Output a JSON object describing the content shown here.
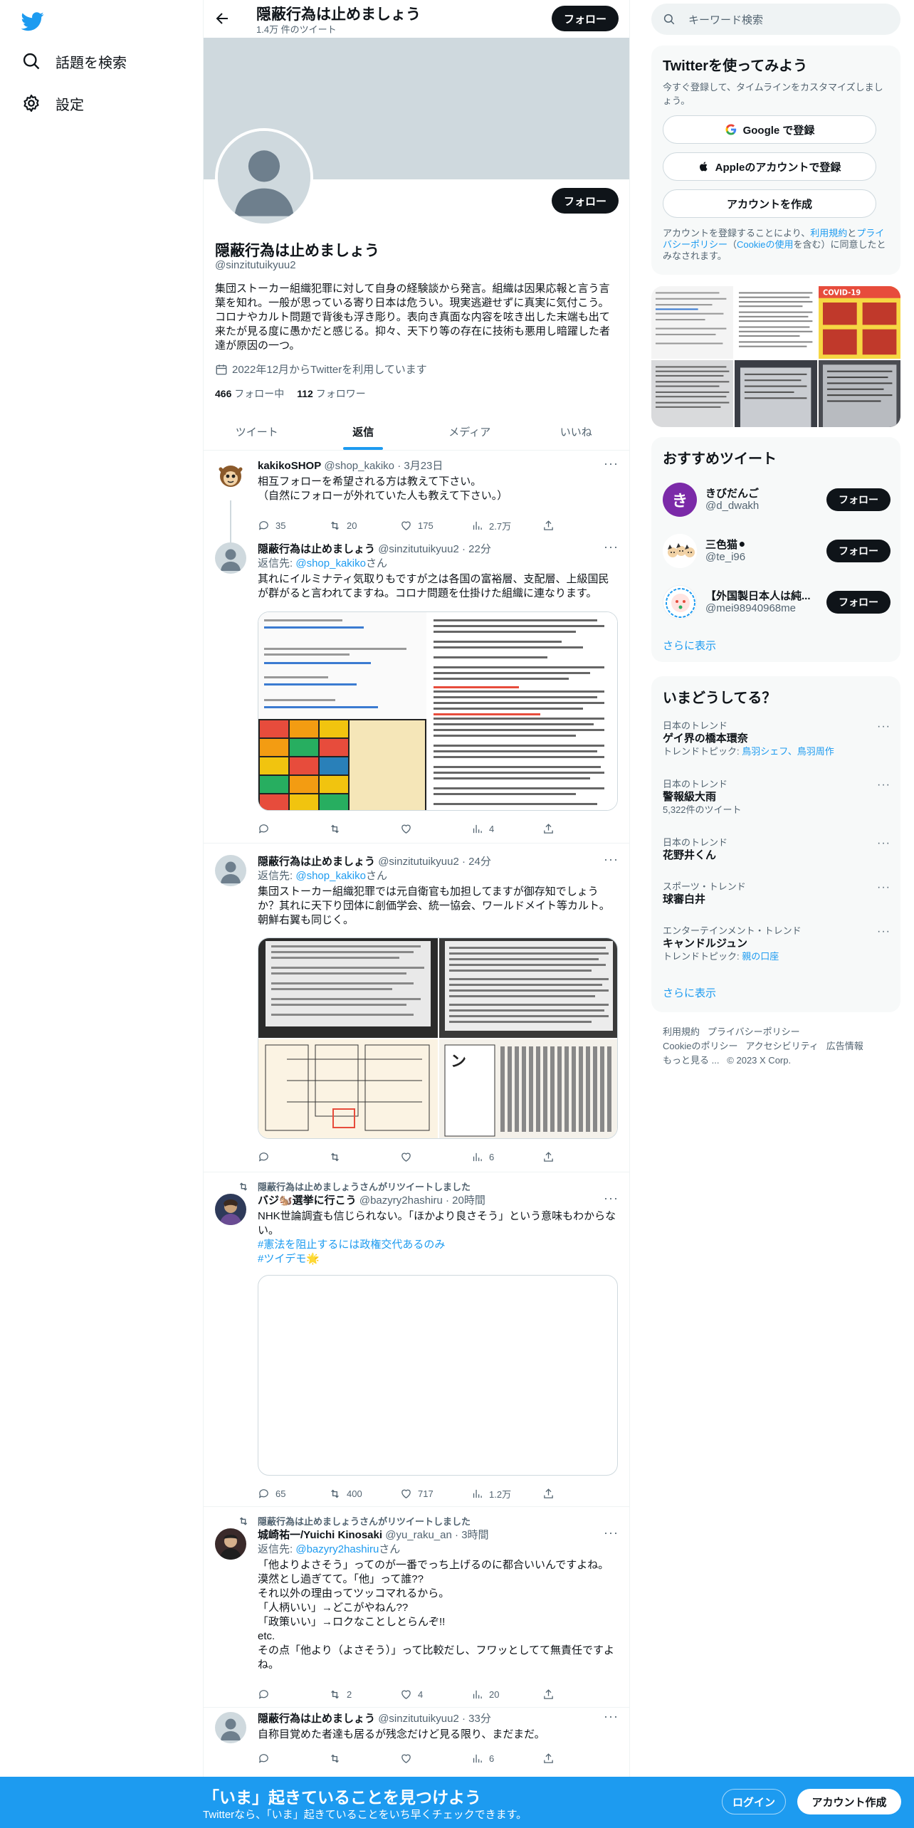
{
  "nav": {
    "explore_label": "話題を検索",
    "settings_label": "設定"
  },
  "header": {
    "title": "隠蔽行為は止めましょう",
    "tweet_count": "1.4万 件のツイート",
    "follow_label": "フォロー"
  },
  "profile": {
    "name": "隠蔽行為は止めましょう",
    "handle": "@sinzitutuikyuu2",
    "follow_label": "フォロー",
    "bio": "集団ストーカー組織犯罪に対して自身の経験談から発言。組織は因果応報と言う言葉を知れ。一般が思っている寄り日本は危うい。現実逃避せずに真実に気付こう。コロナやカルト問題で背後も浮き彫り。表向き真面な内容を呟き出した末端も出て来たが見る度に愚かだと感じる。抑々、天下り等の存在に技術も悪用し暗躍した者達が原因の一つ。",
    "joined": "2022年12月からTwitterを利用しています",
    "following_count": "466",
    "following_label": "フォロー中",
    "followers_count": "112",
    "followers_label": "フォロワー"
  },
  "tabs": [
    {
      "label": "ツイート"
    },
    {
      "label": "返信"
    },
    {
      "label": "メディア"
    },
    {
      "label": "いいね"
    }
  ],
  "tweets": [
    {
      "name": "kakikoSHOP",
      "handle": "@shop_kakiko",
      "time": "3月23日",
      "text": "相互フォローを希望される方は教えて下さい。\n（自然にフォローが外れていた人も教えて下さい。）",
      "replies": "35",
      "retweets": "20",
      "likes": "175",
      "views": "2.7万"
    },
    {
      "name": "隠蔽行為は止めましょう",
      "handle": "@sinzitutuikyuu2",
      "time": "22分",
      "reply_prefix": "返信先: ",
      "reply_to": "@shop_kakiko",
      "reply_suffix": "さん",
      "text": "其れにイルミナティ気取りもですが之は各国の富裕層、支配層、上級国民が群がると言われてますね。コロナ問題を仕掛けた組織に連なります。",
      "replies": "",
      "retweets": "",
      "likes": "",
      "views": "4"
    },
    {
      "name": "隠蔽行為は止めましょう",
      "handle": "@sinzitutuikyuu2",
      "time": "24分",
      "reply_prefix": "返信先: ",
      "reply_to": "@shop_kakiko",
      "reply_suffix": "さん",
      "text": "集団ストーカー組織犯罪では元自衛官も加担してますが御存知でしょうか？其れに天下り団体に創価学会、統一協会、ワールドメイト等カルト。朝鮮右翼も同じく。",
      "replies": "",
      "retweets": "",
      "likes": "",
      "views": "6"
    },
    {
      "retweet_by": "隠蔽行為は止めましょうさんがリツイートしました",
      "name": "バジ🐿️選挙に行こう",
      "handle": "@bazyry2hashiru",
      "time": "20時間",
      "text": "NHK世論調査も信じられない。「ほかより良さそう」という意味もわからない。",
      "hashtag1": "#憲法を阻止するには政権交代あるのみ",
      "hashtag2": "#ツイデモ🌟",
      "replies": "65",
      "retweets": "400",
      "likes": "717",
      "views": "1.2万"
    },
    {
      "retweet_by": "隠蔽行為は止めましょうさんがリツイートしました",
      "name": "城崎祐一/Yuichi Kinosaki",
      "handle": "@yu_raku_an",
      "time": "3時間",
      "reply_prefix": "返信先: ",
      "reply_to": "@bazyry2hashiru",
      "reply_suffix": "さん",
      "text": "「他よりよさそう」ってのが一番でっち上げるのに都合いいんですよね。\n漠然とし過ぎてて。「他」って誰??\nそれ以外の理由ってツッコマれるから。\n「人柄いい」→どこがやねん??\n「政策いい」→ロクなことしとらんぞ!!\netc.\nその点「他より（よさそう）」って比較だし、フワッとしてて無責任ですよね。",
      "replies": "",
      "retweets": "2",
      "likes": "4",
      "views": "20"
    },
    {
      "name": "隠蔽行為は止めましょう",
      "handle": "@sinzitutuikyuu2",
      "time": "33分",
      "text": "自称目覚めた者達も居るが残念だけど見る限り、まだまだ。",
      "replies": "",
      "retweets": "",
      "likes": "",
      "views": "6"
    }
  ],
  "sidebar": {
    "search_placeholder": "キーワード検索",
    "signup_title": "Twitterを使ってみよう",
    "signup_sub": "今すぐ登録して、タイムラインをカスタマイズしましょう。",
    "google_label": "Google で登録",
    "apple_label": "Appleのアカウントで登録",
    "create_label": "アカウントを作成",
    "legal_1": "アカウントを登録することにより、",
    "legal_terms": "利用規約",
    "legal_2": "と",
    "legal_privacy": "プライバシーポリシー",
    "legal_3": "（",
    "legal_cookie": "Cookieの使用",
    "legal_4": "を含む）に同意したとみなされます。",
    "rec_title": "おすすめツイート",
    "rec_users": [
      {
        "name": "きびだんご",
        "handle": "@d_dwakh",
        "avatar_char": "き",
        "follow": "フォロー"
      },
      {
        "name": "三色猫⚫",
        "handle": "@te_i96",
        "follow": "フォロー"
      },
      {
        "name": "【外国製日本人は純...",
        "handle": "@mei98940968me",
        "follow": "フォロー"
      }
    ],
    "rec_more": "さらに表示",
    "trends_title": "いまどうしてる？",
    "trends": [
      {
        "category": "日本のトレンド",
        "name": "ゲイ界の橋本環奈",
        "sub_prefix": "トレンドトピック: ",
        "sub_links": "鳥羽シェフ、鳥羽周作"
      },
      {
        "category": "日本のトレンド",
        "name": "警報級大雨",
        "sub": "5,322件のツイート"
      },
      {
        "category": "日本のトレンド",
        "name": "花野井くん"
      },
      {
        "category": "スポーツ・トレンド",
        "name": "球審白井"
      },
      {
        "category": "エンターテインメント・トレンド",
        "name": "キャンドルジュン",
        "sub_prefix": "トレンドトピック: ",
        "sub_links": "親の口座"
      }
    ],
    "trends_more": "さらに表示",
    "footer": {
      "terms": "利用規約",
      "privacy": "プライバシーポリシー",
      "cookie": "Cookieのポリシー",
      "accessibility": "アクセシビリティ",
      "ads": "広告情報",
      "more": "もっと見る ...",
      "copyright": "© 2023 X Corp."
    }
  },
  "bottombar": {
    "title": "「いま」起きていることを見つけよう",
    "sub": "Twitterなら、「いま」起きていることをいち早くチェックできます。",
    "login": "ログイン",
    "signup": "アカウント作成"
  },
  "colors": {
    "accent": "#1d9bf0",
    "text": "#0f1419",
    "muted": "#536471",
    "border": "#eff3f4"
  }
}
